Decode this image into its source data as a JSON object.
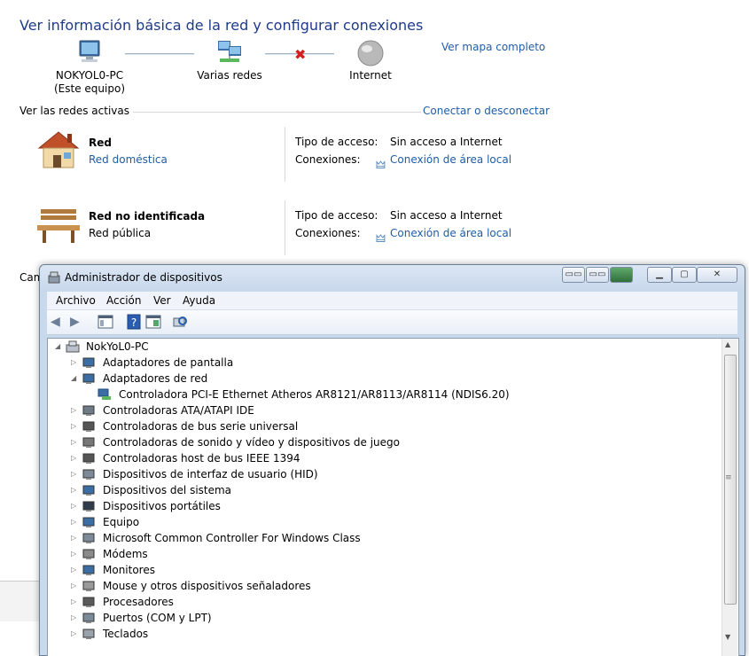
{
  "network_center": {
    "title": "Ver información básica de la red y configurar conexiones",
    "full_map_link": "Ver mapa completo",
    "map_nodes": [
      {
        "label": "NOKYOL0-PC",
        "sub": "(Este equipo)"
      },
      {
        "label": "Varias redes",
        "sub": ""
      },
      {
        "label": "Internet",
        "sub": ""
      }
    ],
    "active_networks_label": "Ver las redes activas",
    "connect_link": "Conectar o desconectar",
    "networks": [
      {
        "name": "Red",
        "type": "Red doméstica",
        "type_is_link": true,
        "access_label": "Tipo de acceso:",
        "access_value": "Sin acceso a Internet",
        "conn_label": "Conexiones:",
        "conn_value": "Conexión de área local"
      },
      {
        "name": "Red no identificada",
        "type": "Red pública",
        "type_is_link": false,
        "access_label": "Tipo de acceso:",
        "access_value": "Sin acceso a Internet",
        "conn_label": "Conexiones:",
        "conn_value": "Conexión de área local"
      }
    ],
    "obscured_text": "Cam"
  },
  "device_manager": {
    "title": "Administrador de dispositivos",
    "menu": [
      "Archivo",
      "Acción",
      "Ver",
      "Ayuda"
    ],
    "root": "NokYoL0-PC",
    "tree": [
      {
        "label": "Adaptadores de pantalla",
        "expanded": false,
        "icon": "monitor-icon"
      },
      {
        "label": "Adaptadores de red",
        "expanded": true,
        "icon": "network-icon",
        "children": [
          "Controladora PCI-E Ethernet Atheros AR8121/AR8113/AR8114 (NDIS6.20)"
        ]
      },
      {
        "label": "Controladoras ATA/ATAPI IDE",
        "expanded": false,
        "icon": "drive-icon"
      },
      {
        "label": "Controladoras de bus serie universal",
        "expanded": false,
        "icon": "usb-icon"
      },
      {
        "label": "Controladoras de sonido y vídeo y dispositivos de juego",
        "expanded": false,
        "icon": "speaker-icon"
      },
      {
        "label": "Controladoras host de bus IEEE 1394",
        "expanded": false,
        "icon": "usb-icon"
      },
      {
        "label": "Dispositivos de interfaz de usuario (HID)",
        "expanded": false,
        "icon": "hid-icon"
      },
      {
        "label": "Dispositivos del sistema",
        "expanded": false,
        "icon": "computer-icon"
      },
      {
        "label": "Dispositivos portátiles",
        "expanded": false,
        "icon": "portable-icon"
      },
      {
        "label": "Equipo",
        "expanded": false,
        "icon": "computer-icon"
      },
      {
        "label": "Microsoft Common Controller For Windows Class",
        "expanded": false,
        "icon": "hid-icon"
      },
      {
        "label": "Módems",
        "expanded": false,
        "icon": "modem-icon"
      },
      {
        "label": "Monitores",
        "expanded": false,
        "icon": "monitor-icon"
      },
      {
        "label": "Mouse y otros dispositivos señaladores",
        "expanded": false,
        "icon": "mouse-icon"
      },
      {
        "label": "Procesadores",
        "expanded": false,
        "icon": "cpu-icon"
      },
      {
        "label": "Puertos (COM y LPT)",
        "expanded": false,
        "icon": "port-icon"
      },
      {
        "label": "Teclados",
        "expanded": false,
        "icon": "keyboard-icon"
      }
    ]
  }
}
